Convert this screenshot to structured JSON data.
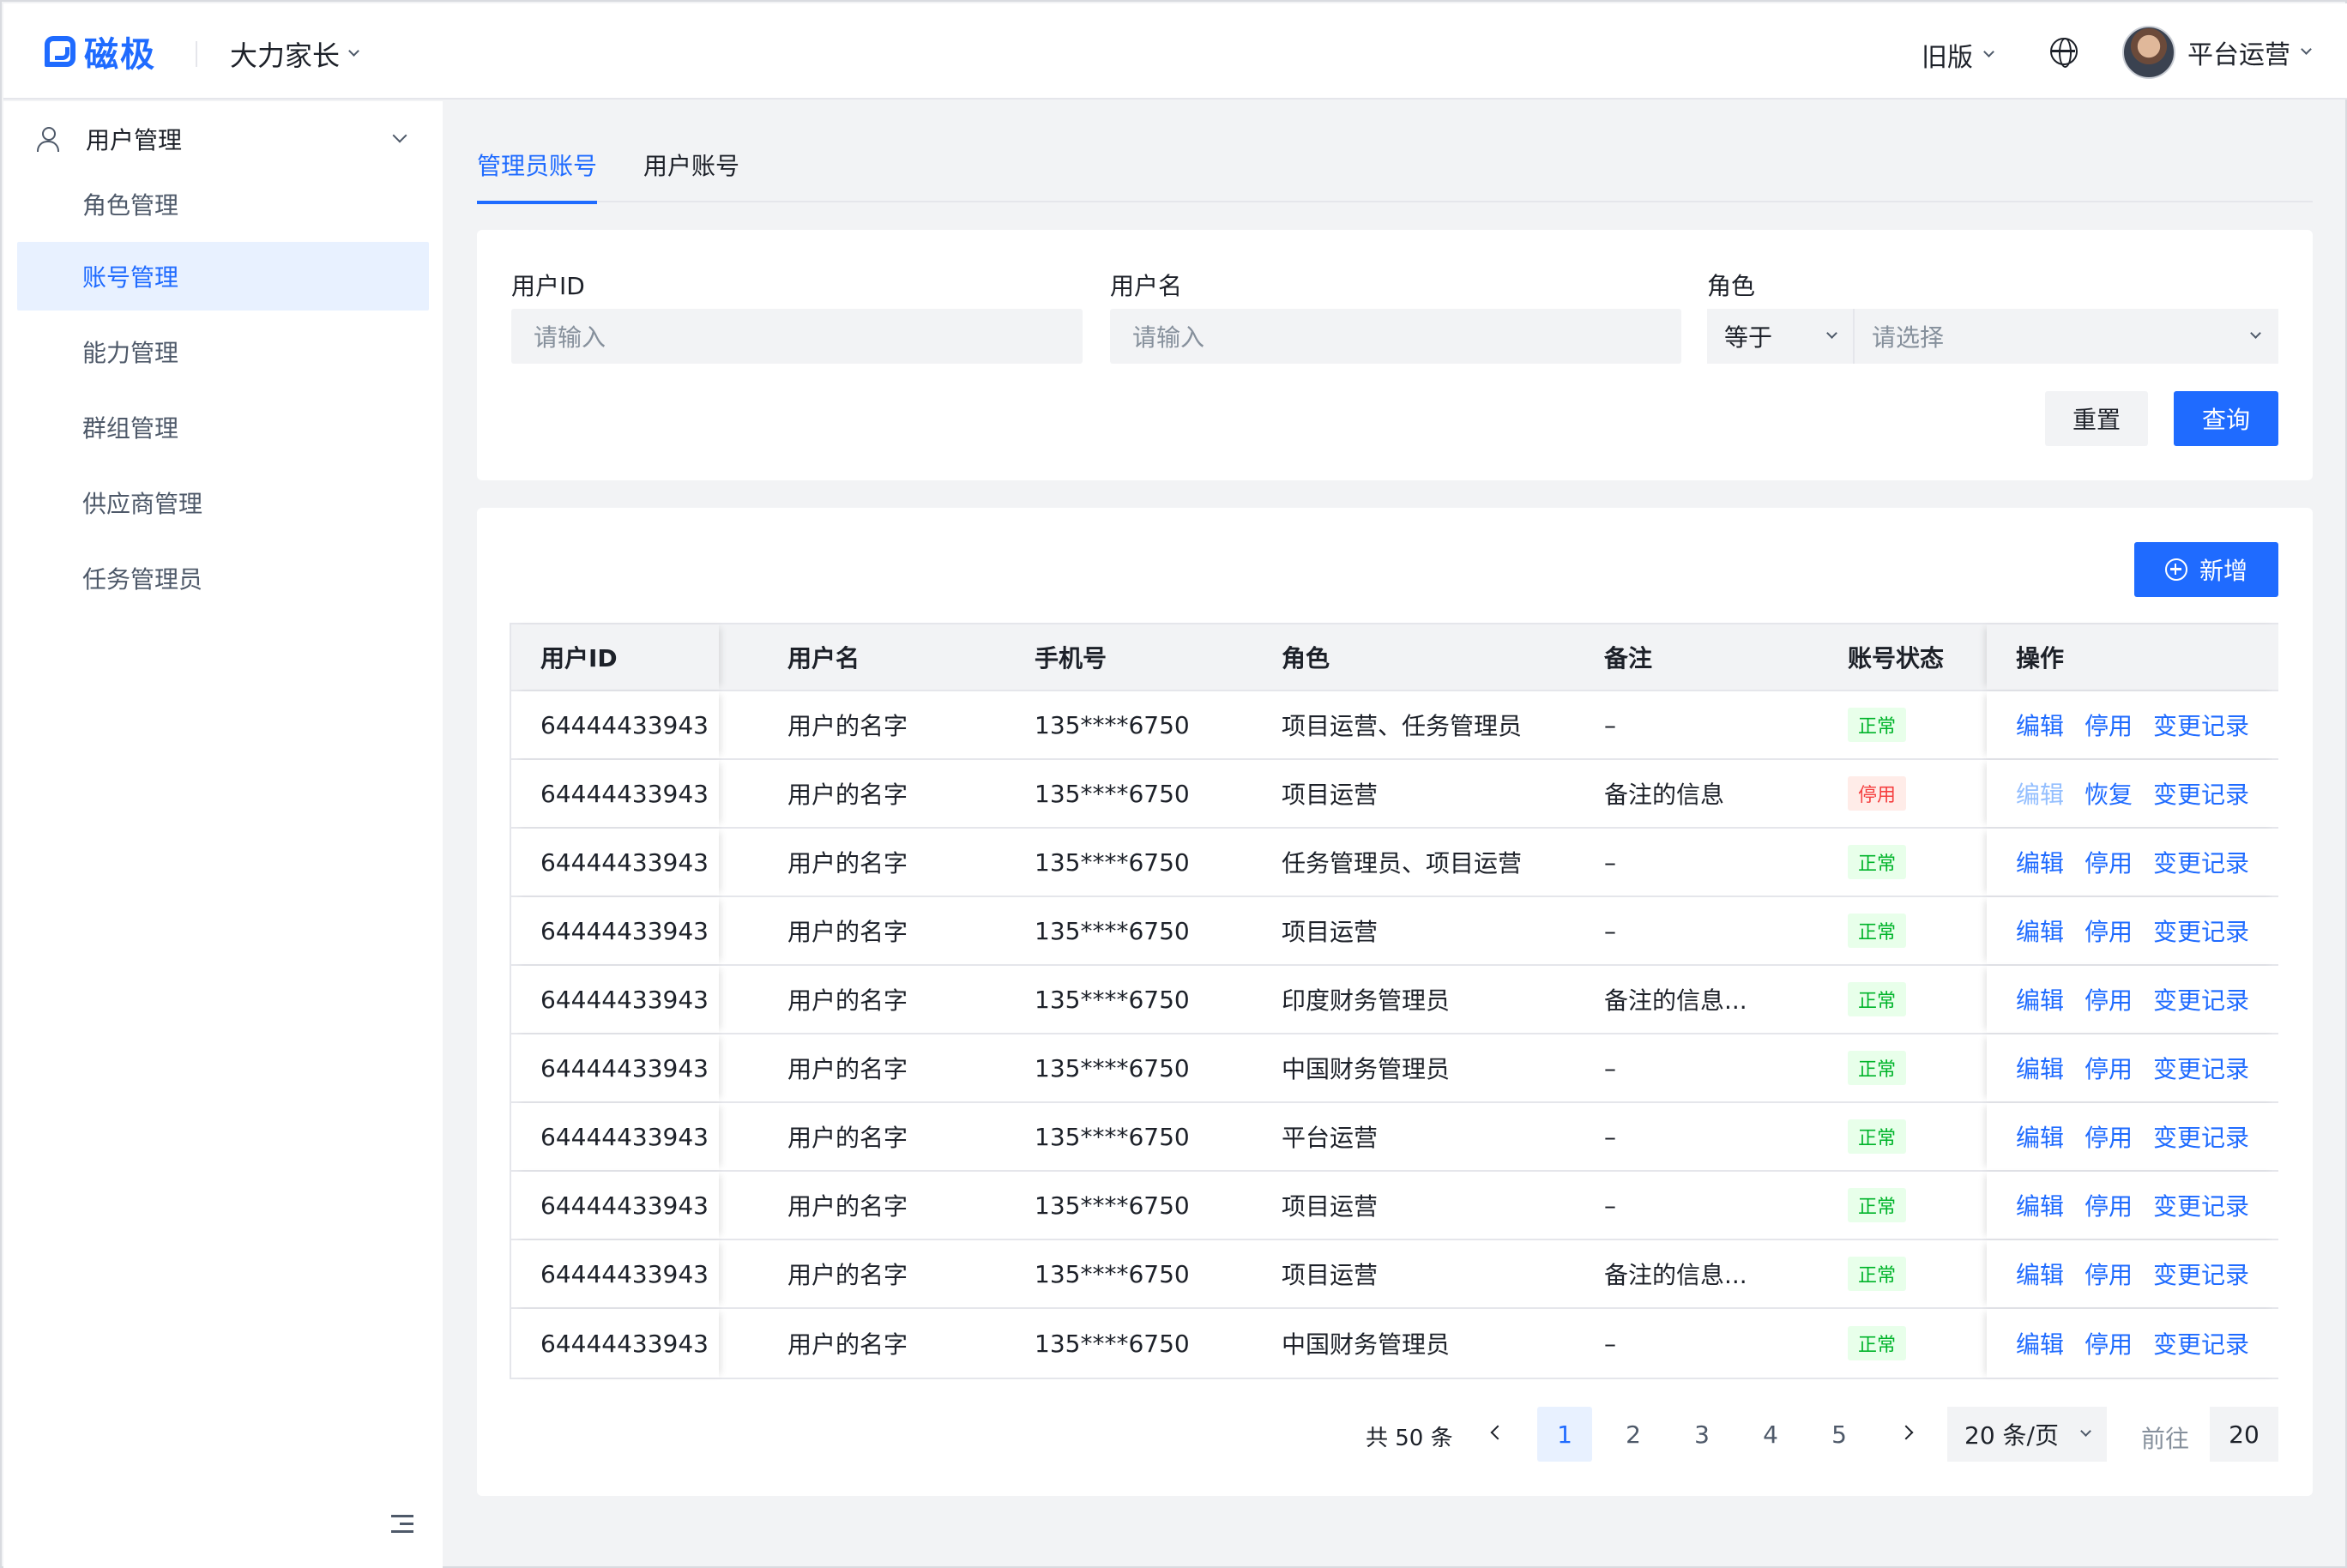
{
  "header": {
    "logo_text": "磁极",
    "org_name": "大力家长",
    "old_version": "旧版",
    "user_name": "平台运营"
  },
  "sidebar": {
    "group_label": "用户管理",
    "items": [
      {
        "label": "角色管理",
        "active": false
      },
      {
        "label": "账号管理",
        "active": true
      },
      {
        "label": "能力管理",
        "active": false
      },
      {
        "label": "群组管理",
        "active": false
      },
      {
        "label": "供应商管理",
        "active": false
      },
      {
        "label": "任务管理员",
        "active": false
      }
    ]
  },
  "tabs": [
    {
      "label": "管理员账号",
      "active": true
    },
    {
      "label": "用户账号",
      "active": false
    }
  ],
  "filter": {
    "user_id_label": "用户ID",
    "user_id_placeholder": "请输入",
    "username_label": "用户名",
    "username_placeholder": "请输入",
    "role_label": "角色",
    "role_operator": "等于",
    "role_placeholder": "请选择",
    "reset_label": "重置",
    "query_label": "查询"
  },
  "table": {
    "add_label": "新增",
    "columns": [
      "用户ID",
      "用户名",
      "手机号",
      "角色",
      "备注",
      "账号状态",
      "操作"
    ],
    "rows": [
      {
        "id": "64444433943",
        "name": "用户的名字",
        "phone": "135****6750",
        "role": "项目运营、任务管理员",
        "note": "–",
        "status": "正常",
        "ok": true,
        "op1": "编辑",
        "op2": "停用",
        "op3": "变更记录"
      },
      {
        "id": "64444433943",
        "name": "用户的名字",
        "phone": "135****6750",
        "role": "项目运营",
        "note": "备注的信息",
        "status": "停用",
        "ok": false,
        "op1": "编辑",
        "op2": "恢复",
        "op3": "变更记录"
      },
      {
        "id": "64444433943",
        "name": "用户的名字",
        "phone": "135****6750",
        "role": "任务管理员、项目运营",
        "note": "–",
        "status": "正常",
        "ok": true,
        "op1": "编辑",
        "op2": "停用",
        "op3": "变更记录"
      },
      {
        "id": "64444433943",
        "name": "用户的名字",
        "phone": "135****6750",
        "role": "项目运营",
        "note": "–",
        "status": "正常",
        "ok": true,
        "op1": "编辑",
        "op2": "停用",
        "op3": "变更记录"
      },
      {
        "id": "64444433943",
        "name": "用户的名字",
        "phone": "135****6750",
        "role": "印度财务管理员",
        "note": "备注的信息...",
        "status": "正常",
        "ok": true,
        "op1": "编辑",
        "op2": "停用",
        "op3": "变更记录"
      },
      {
        "id": "64444433943",
        "name": "用户的名字",
        "phone": "135****6750",
        "role": "中国财务管理员",
        "note": "–",
        "status": "正常",
        "ok": true,
        "op1": "编辑",
        "op2": "停用",
        "op3": "变更记录"
      },
      {
        "id": "64444433943",
        "name": "用户的名字",
        "phone": "135****6750",
        "role": "平台运营",
        "note": "–",
        "status": "正常",
        "ok": true,
        "op1": "编辑",
        "op2": "停用",
        "op3": "变更记录"
      },
      {
        "id": "64444433943",
        "name": "用户的名字",
        "phone": "135****6750",
        "role": "项目运营",
        "note": "–",
        "status": "正常",
        "ok": true,
        "op1": "编辑",
        "op2": "停用",
        "op3": "变更记录"
      },
      {
        "id": "64444433943",
        "name": "用户的名字",
        "phone": "135****6750",
        "role": "项目运营",
        "note": "备注的信息...",
        "status": "正常",
        "ok": true,
        "op1": "编辑",
        "op2": "停用",
        "op3": "变更记录"
      },
      {
        "id": "64444433943",
        "name": "用户的名字",
        "phone": "135****6750",
        "role": "中国财务管理员",
        "note": "–",
        "status": "正常",
        "ok": true,
        "op1": "编辑",
        "op2": "停用",
        "op3": "变更记录"
      }
    ]
  },
  "pagination": {
    "total": "共 50 条",
    "pages": [
      "1",
      "2",
      "3",
      "4",
      "5"
    ],
    "current": "1",
    "page_size": "20 条/页",
    "goto_label": "前往",
    "goto_value": "20"
  },
  "colors": {
    "primary": "#1f6bff",
    "success": "#00b42a",
    "danger": "#f53f3f"
  }
}
